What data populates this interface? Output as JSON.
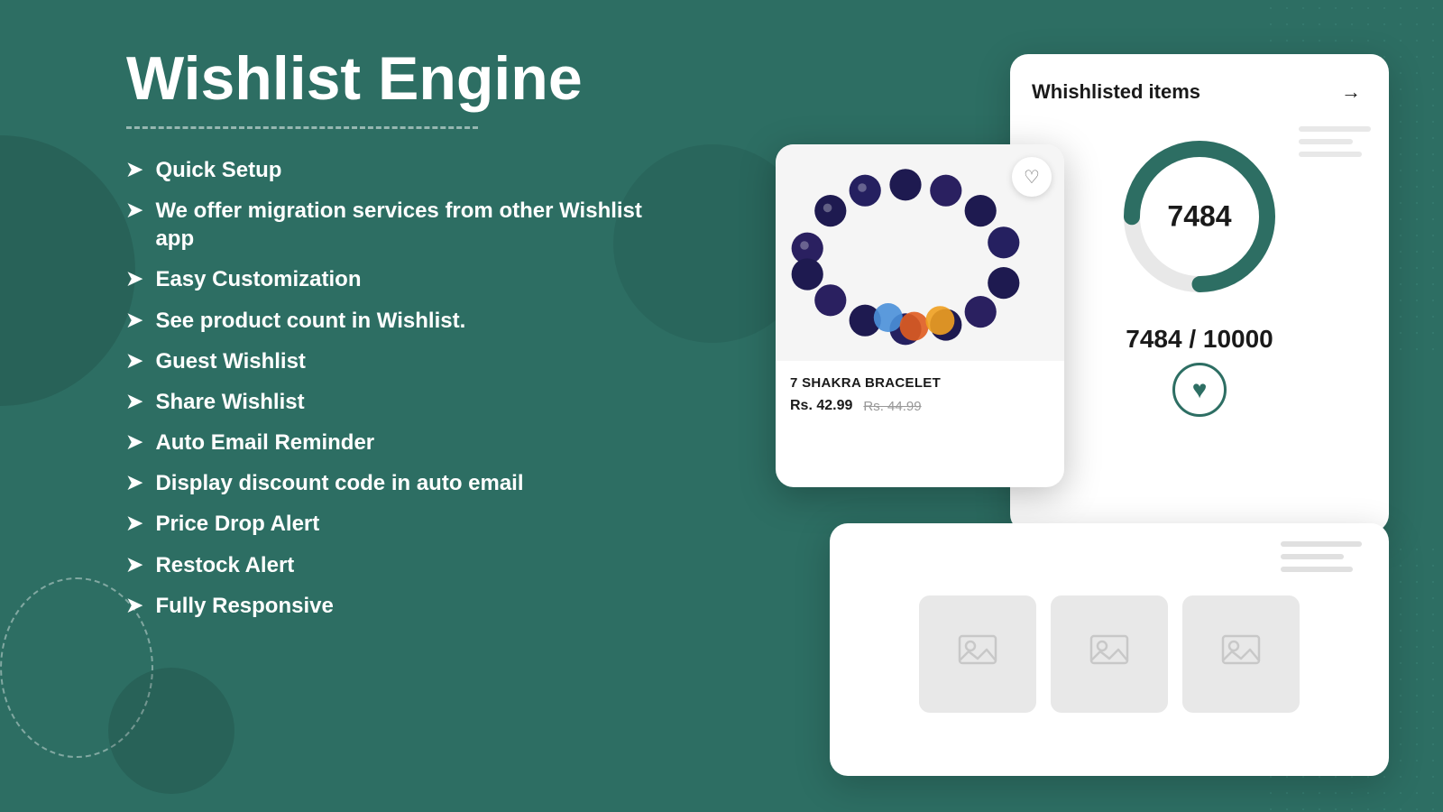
{
  "app": {
    "title": "Wishlist Engine",
    "title_underline": true
  },
  "features": [
    {
      "id": "quick-setup",
      "text": "Quick Setup"
    },
    {
      "id": "migration",
      "text": "We offer migration services from other Wishlist app"
    },
    {
      "id": "customization",
      "text": "Easy Customization"
    },
    {
      "id": "product-count",
      "text": "See product count in Wishlist."
    },
    {
      "id": "guest-wishlist",
      "text": "Guest Wishlist"
    },
    {
      "id": "share-wishlist",
      "text": "Share Wishlist"
    },
    {
      "id": "auto-email",
      "text": "Auto Email Reminder"
    },
    {
      "id": "discount-code",
      "text": "Display discount code in auto email"
    },
    {
      "id": "price-drop",
      "text": "Price Drop Alert"
    },
    {
      "id": "restock",
      "text": "Restock Alert"
    },
    {
      "id": "responsive",
      "text": "Fully Responsive"
    }
  ],
  "wishlist_widget": {
    "title": "Whishlisted items",
    "arrow": "→",
    "count": "7484",
    "fraction": "7484 / 10000"
  },
  "product_card": {
    "name": "7 SHAKRA BRACELET",
    "price_current": "Rs. 42.99",
    "price_original": "Rs. 44.99"
  },
  "colors": {
    "primary": "#2d6e63",
    "white": "#ffffff",
    "text_dark": "#1a1a1a"
  }
}
